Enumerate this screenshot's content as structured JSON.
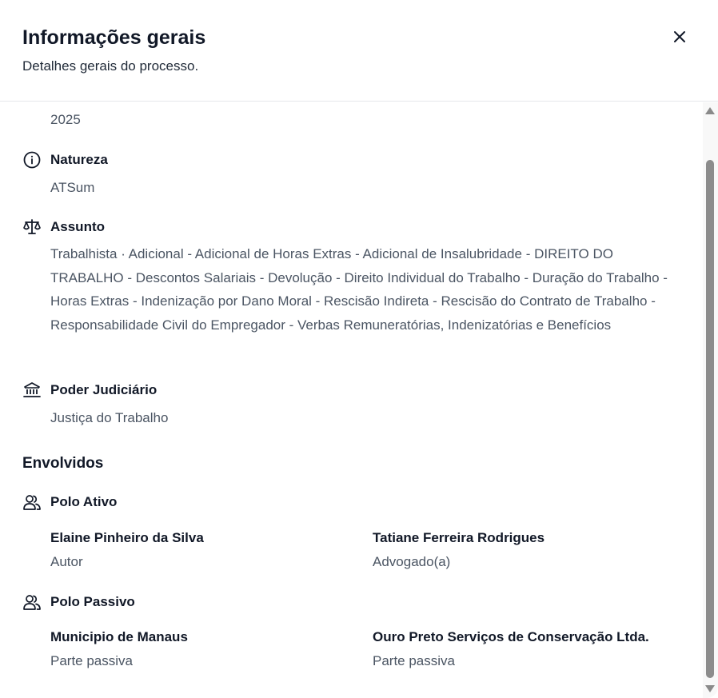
{
  "dialog": {
    "title": "Informações gerais",
    "subtitle": "Detalhes gerais do processo.",
    "close_icon": "close-icon"
  },
  "fields": {
    "year_value": "2025",
    "natureza": {
      "label": "Natureza",
      "value": "ATSum",
      "icon": "info-icon"
    },
    "assunto": {
      "label": "Assunto",
      "value": "Trabalhista · Adicional - Adicional de Horas Extras - Adicional de Insalubridade - DIREITO DO TRABALHO - Descontos Salariais - Devolução - Direito Individual do Trabalho - Duração do Trabalho - Horas Extras - Indenização por Dano Moral - Rescisão Indireta - Rescisão do Contrato de Trabalho - Responsabilidade Civil do Empregador - Verbas Remuneratórias, Indenizatórias e Benefícios",
      "icon": "scale-icon"
    },
    "poder_judiciario": {
      "label": "Poder Judiciário",
      "value": "Justiça do Trabalho",
      "icon": "courthouse-icon"
    }
  },
  "envolvidos": {
    "title": "Envolvidos",
    "polo_ativo": {
      "label": "Polo Ativo",
      "icon": "users-icon",
      "people": [
        {
          "name": "Elaine Pinheiro da Silva",
          "role": "Autor"
        },
        {
          "name": "Tatiane Ferreira Rodrigues",
          "role": "Advogado(a)"
        }
      ]
    },
    "polo_passivo": {
      "label": "Polo Passivo",
      "icon": "users-icon",
      "people": [
        {
          "name": "Municipio de Manaus",
          "role": "Parte passiva"
        },
        {
          "name": "Ouro Preto Serviços de Conservação Ltda.",
          "role": "Parte passiva"
        }
      ]
    }
  },
  "colors": {
    "heading": "#111827",
    "muted": "#4b5563",
    "divider": "#e5e7eb",
    "scrollbar_thumb": "#8c8c8c"
  }
}
